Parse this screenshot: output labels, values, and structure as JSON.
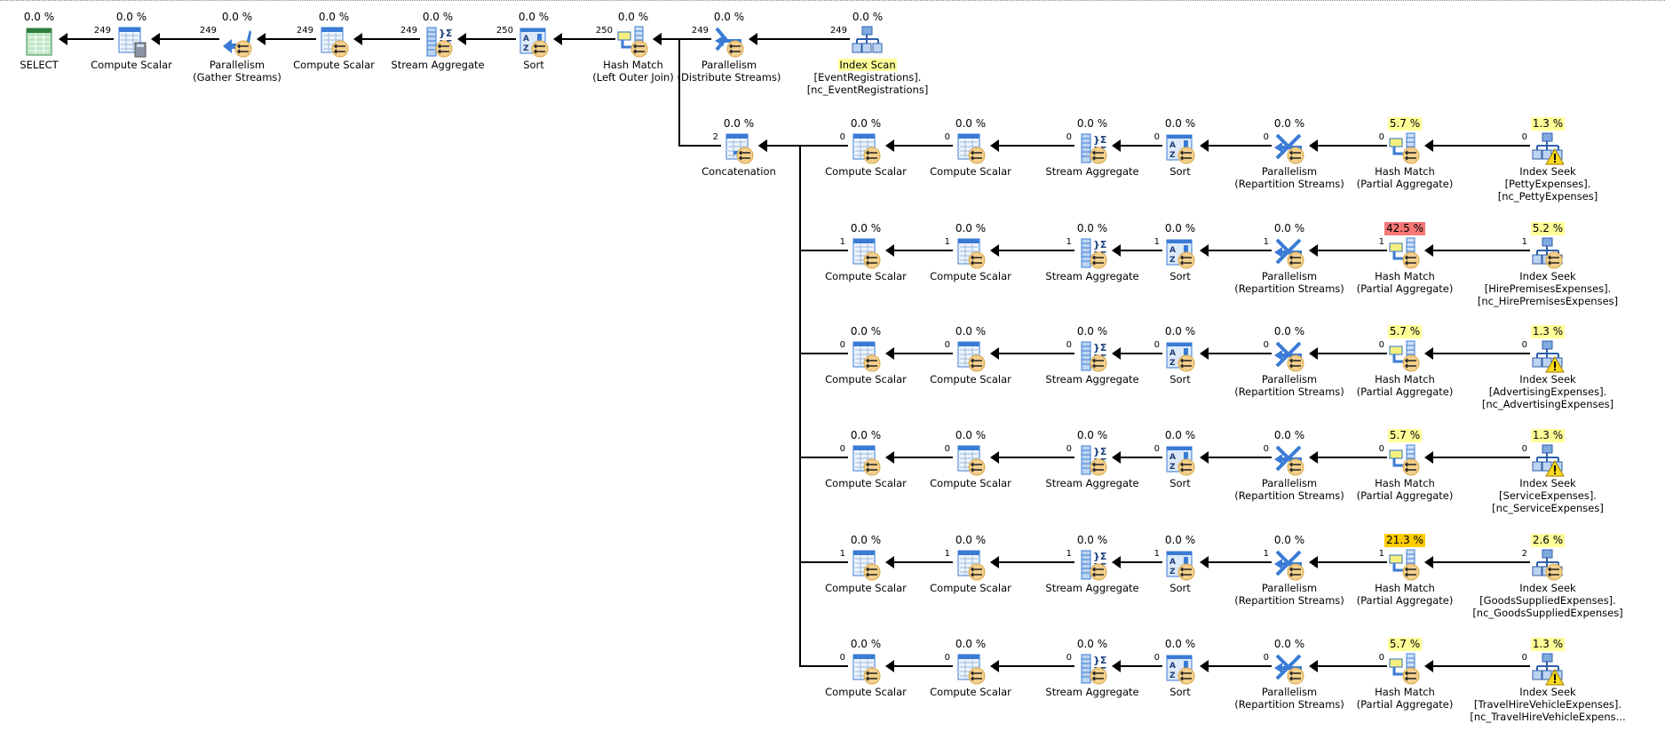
{
  "colors": {
    "cost_low": "#ffff99",
    "cost_high": "#f87878",
    "cost_mid": "#ffcc00",
    "selected_label": "#ffff99",
    "line": "#000000"
  },
  "top_row": [
    {
      "op": "select",
      "icon": "select-icon",
      "cost": "0.0 %",
      "label": [
        "SELECT"
      ]
    },
    {
      "op": "compute",
      "icon": "compute-scalar-icon",
      "cost": "0.0 %",
      "rows": "249",
      "label": [
        "Compute Scalar"
      ],
      "calc": true
    },
    {
      "op": "gather",
      "icon": "parallelism-gather-icon",
      "cost": "0.0 %",
      "rows": "249",
      "label": [
        "Parallelism",
        "(Gather Streams)"
      ],
      "parallel": true
    },
    {
      "op": "compute",
      "icon": "compute-scalar-icon",
      "cost": "0.0 %",
      "rows": "249",
      "label": [
        "Compute Scalar"
      ],
      "parallel": true
    },
    {
      "op": "aggregate",
      "icon": "stream-aggregate-icon",
      "cost": "0.0 %",
      "rows": "249",
      "label": [
        "Stream Aggregate"
      ],
      "parallel": true
    },
    {
      "op": "sort",
      "icon": "sort-icon",
      "cost": "0.0 %",
      "rows": "250",
      "label": [
        "Sort"
      ],
      "parallel": true
    },
    {
      "op": "hash",
      "icon": "hash-match-icon",
      "cost": "0.0 %",
      "rows": "250",
      "label": [
        "Hash Match",
        "(Left Outer Join)"
      ],
      "parallel": true
    },
    {
      "op": "distribute",
      "icon": "parallelism-distribute-icon",
      "cost": "0.0 %",
      "rows": "249",
      "label": [
        "Parallelism",
        "(Distribute Streams)"
      ],
      "parallel": true
    },
    {
      "op": "indexscan",
      "icon": "index-scan-icon",
      "cost": "0.0 %",
      "rows": "249",
      "label": [
        "Index Scan",
        "[EventRegistrations].",
        "[nc_EventRegistrations]"
      ],
      "selected": true
    }
  ],
  "concatenation": {
    "op": "concat",
    "icon": "concatenation-icon",
    "cost": "0.0 %",
    "rows": "2",
    "label": [
      "Concatenation"
    ],
    "parallel": true
  },
  "branches": [
    {
      "nodes": [
        {
          "op": "compute",
          "icon": "compute-scalar-icon",
          "cost": "0.0 %",
          "rows": "0",
          "label": [
            "Compute Scalar"
          ],
          "parallel": true
        },
        {
          "op": "compute",
          "icon": "compute-scalar-icon",
          "cost": "0.0 %",
          "rows": "0",
          "label": [
            "Compute Scalar"
          ],
          "parallel": true
        },
        {
          "op": "aggregate",
          "icon": "stream-aggregate-icon",
          "cost": "0.0 %",
          "rows": "0",
          "label": [
            "Stream Aggregate"
          ],
          "parallel": true
        },
        {
          "op": "sort",
          "icon": "sort-icon",
          "cost": "0.0 %",
          "rows": "0",
          "label": [
            "Sort"
          ],
          "parallel": true
        },
        {
          "op": "repartition",
          "icon": "parallelism-repartition-icon",
          "cost": "0.0 %",
          "rows": "0",
          "label": [
            "Parallelism",
            "(Repartition Streams)"
          ],
          "parallel": true
        },
        {
          "op": "hash",
          "icon": "hash-match-icon",
          "cost": "5.7 %",
          "level": "low",
          "rows": "0",
          "label": [
            "Hash Match",
            "(Partial Aggregate)"
          ],
          "parallel": true
        },
        {
          "op": "indexseek",
          "icon": "index-seek-icon",
          "cost": "1.3 %",
          "level": "low",
          "rows": "0",
          "label": [
            "Index Seek",
            "[PettyExpenses].",
            "[nc_PettyExpenses]"
          ],
          "warning": true
        }
      ]
    },
    {
      "nodes": [
        {
          "op": "compute",
          "icon": "compute-scalar-icon",
          "cost": "0.0 %",
          "rows": "1",
          "label": [
            "Compute Scalar"
          ],
          "parallel": true
        },
        {
          "op": "compute",
          "icon": "compute-scalar-icon",
          "cost": "0.0 %",
          "rows": "1",
          "label": [
            "Compute Scalar"
          ],
          "parallel": true
        },
        {
          "op": "aggregate",
          "icon": "stream-aggregate-icon",
          "cost": "0.0 %",
          "rows": "1",
          "label": [
            "Stream Aggregate"
          ],
          "parallel": true
        },
        {
          "op": "sort",
          "icon": "sort-icon",
          "cost": "0.0 %",
          "rows": "1",
          "label": [
            "Sort"
          ],
          "parallel": true
        },
        {
          "op": "repartition",
          "icon": "parallelism-repartition-icon",
          "cost": "0.0 %",
          "rows": "1",
          "label": [
            "Parallelism",
            "(Repartition Streams)"
          ],
          "parallel": true
        },
        {
          "op": "hash",
          "icon": "hash-match-icon",
          "cost": "42.5 %",
          "level": "high",
          "rows": "1",
          "label": [
            "Hash Match",
            "(Partial Aggregate)"
          ],
          "parallel": true
        },
        {
          "op": "indexseek",
          "icon": "index-seek-icon",
          "cost": "5.2 %",
          "level": "low",
          "rows": "1",
          "label": [
            "Index Seek",
            "[HirePremisesExpenses].",
            "[nc_HirePremisesExpenses]"
          ],
          "parallel": true
        }
      ]
    },
    {
      "nodes": [
        {
          "op": "compute",
          "icon": "compute-scalar-icon",
          "cost": "0.0 %",
          "rows": "0",
          "label": [
            "Compute Scalar"
          ],
          "parallel": true
        },
        {
          "op": "compute",
          "icon": "compute-scalar-icon",
          "cost": "0.0 %",
          "rows": "0",
          "label": [
            "Compute Scalar"
          ],
          "parallel": true
        },
        {
          "op": "aggregate",
          "icon": "stream-aggregate-icon",
          "cost": "0.0 %",
          "rows": "0",
          "label": [
            "Stream Aggregate"
          ],
          "parallel": true
        },
        {
          "op": "sort",
          "icon": "sort-icon",
          "cost": "0.0 %",
          "rows": "0",
          "label": [
            "Sort"
          ],
          "parallel": true
        },
        {
          "op": "repartition",
          "icon": "parallelism-repartition-icon",
          "cost": "0.0 %",
          "rows": "0",
          "label": [
            "Parallelism",
            "(Repartition Streams)"
          ],
          "parallel": true
        },
        {
          "op": "hash",
          "icon": "hash-match-icon",
          "cost": "5.7 %",
          "level": "low",
          "rows": "0",
          "label": [
            "Hash Match",
            "(Partial Aggregate)"
          ],
          "parallel": true
        },
        {
          "op": "indexseek",
          "icon": "index-seek-icon",
          "cost": "1.3 %",
          "level": "low",
          "rows": "0",
          "label": [
            "Index Seek",
            "[AdvertisingExpenses].",
            "[nc_AdvertisingExpenses]"
          ],
          "warning": true
        }
      ]
    },
    {
      "nodes": [
        {
          "op": "compute",
          "icon": "compute-scalar-icon",
          "cost": "0.0 %",
          "rows": "0",
          "label": [
            "Compute Scalar"
          ],
          "parallel": true
        },
        {
          "op": "compute",
          "icon": "compute-scalar-icon",
          "cost": "0.0 %",
          "rows": "0",
          "label": [
            "Compute Scalar"
          ],
          "parallel": true
        },
        {
          "op": "aggregate",
          "icon": "stream-aggregate-icon",
          "cost": "0.0 %",
          "rows": "0",
          "label": [
            "Stream Aggregate"
          ],
          "parallel": true
        },
        {
          "op": "sort",
          "icon": "sort-icon",
          "cost": "0.0 %",
          "rows": "0",
          "label": [
            "Sort"
          ],
          "parallel": true
        },
        {
          "op": "repartition",
          "icon": "parallelism-repartition-icon",
          "cost": "0.0 %",
          "rows": "0",
          "label": [
            "Parallelism",
            "(Repartition Streams)"
          ],
          "parallel": true
        },
        {
          "op": "hash",
          "icon": "hash-match-icon",
          "cost": "5.7 %",
          "level": "low",
          "rows": "0",
          "label": [
            "Hash Match",
            "(Partial Aggregate)"
          ],
          "parallel": true
        },
        {
          "op": "indexseek",
          "icon": "index-seek-icon",
          "cost": "1.3 %",
          "level": "low",
          "rows": "0",
          "label": [
            "Index Seek",
            "[ServiceExpenses].",
            "[nc_ServiceExpenses]"
          ],
          "warning": true
        }
      ]
    },
    {
      "nodes": [
        {
          "op": "compute",
          "icon": "compute-scalar-icon",
          "cost": "0.0 %",
          "rows": "1",
          "label": [
            "Compute Scalar"
          ],
          "parallel": true
        },
        {
          "op": "compute",
          "icon": "compute-scalar-icon",
          "cost": "0.0 %",
          "rows": "1",
          "label": [
            "Compute Scalar"
          ],
          "parallel": true
        },
        {
          "op": "aggregate",
          "icon": "stream-aggregate-icon",
          "cost": "0.0 %",
          "rows": "1",
          "label": [
            "Stream Aggregate"
          ],
          "parallel": true
        },
        {
          "op": "sort",
          "icon": "sort-icon",
          "cost": "0.0 %",
          "rows": "1",
          "label": [
            "Sort"
          ],
          "parallel": true
        },
        {
          "op": "repartition",
          "icon": "parallelism-repartition-icon",
          "cost": "0.0 %",
          "rows": "1",
          "label": [
            "Parallelism",
            "(Repartition Streams)"
          ],
          "parallel": true
        },
        {
          "op": "hash",
          "icon": "hash-match-icon",
          "cost": "21.3 %",
          "level": "mid",
          "rows": "1",
          "label": [
            "Hash Match",
            "(Partial Aggregate)"
          ],
          "parallel": true
        },
        {
          "op": "indexseek",
          "icon": "index-seek-icon",
          "cost": "2.6 %",
          "level": "low",
          "rows": "2",
          "label": [
            "Index Seek",
            "[GoodsSuppliedExpenses].",
            "[nc_GoodsSuppliedExpenses]"
          ],
          "parallel": true
        }
      ]
    },
    {
      "nodes": [
        {
          "op": "compute",
          "icon": "compute-scalar-icon",
          "cost": "0.0 %",
          "rows": "0",
          "label": [
            "Compute Scalar"
          ],
          "parallel": true
        },
        {
          "op": "compute",
          "icon": "compute-scalar-icon",
          "cost": "0.0 %",
          "rows": "0",
          "label": [
            "Compute Scalar"
          ],
          "parallel": true
        },
        {
          "op": "aggregate",
          "icon": "stream-aggregate-icon",
          "cost": "0.0 %",
          "rows": "0",
          "label": [
            "Stream Aggregate"
          ],
          "parallel": true
        },
        {
          "op": "sort",
          "icon": "sort-icon",
          "cost": "0.0 %",
          "rows": "0",
          "label": [
            "Sort"
          ],
          "parallel": true
        },
        {
          "op": "repartition",
          "icon": "parallelism-repartition-icon",
          "cost": "0.0 %",
          "rows": "0",
          "label": [
            "Parallelism",
            "(Repartition Streams)"
          ],
          "parallel": true
        },
        {
          "op": "hash",
          "icon": "hash-match-icon",
          "cost": "5.7 %",
          "level": "low",
          "rows": "0",
          "label": [
            "Hash Match",
            "(Partial Aggregate)"
          ],
          "parallel": true
        },
        {
          "op": "indexseek",
          "icon": "index-seek-icon",
          "cost": "1.3 %",
          "level": "low",
          "rows": "0",
          "label": [
            "Index Seek",
            "[TravelHireVehicleExpenses].",
            "[nc_TravelHireVehicleExpens..."
          ],
          "warning": true
        }
      ]
    }
  ]
}
